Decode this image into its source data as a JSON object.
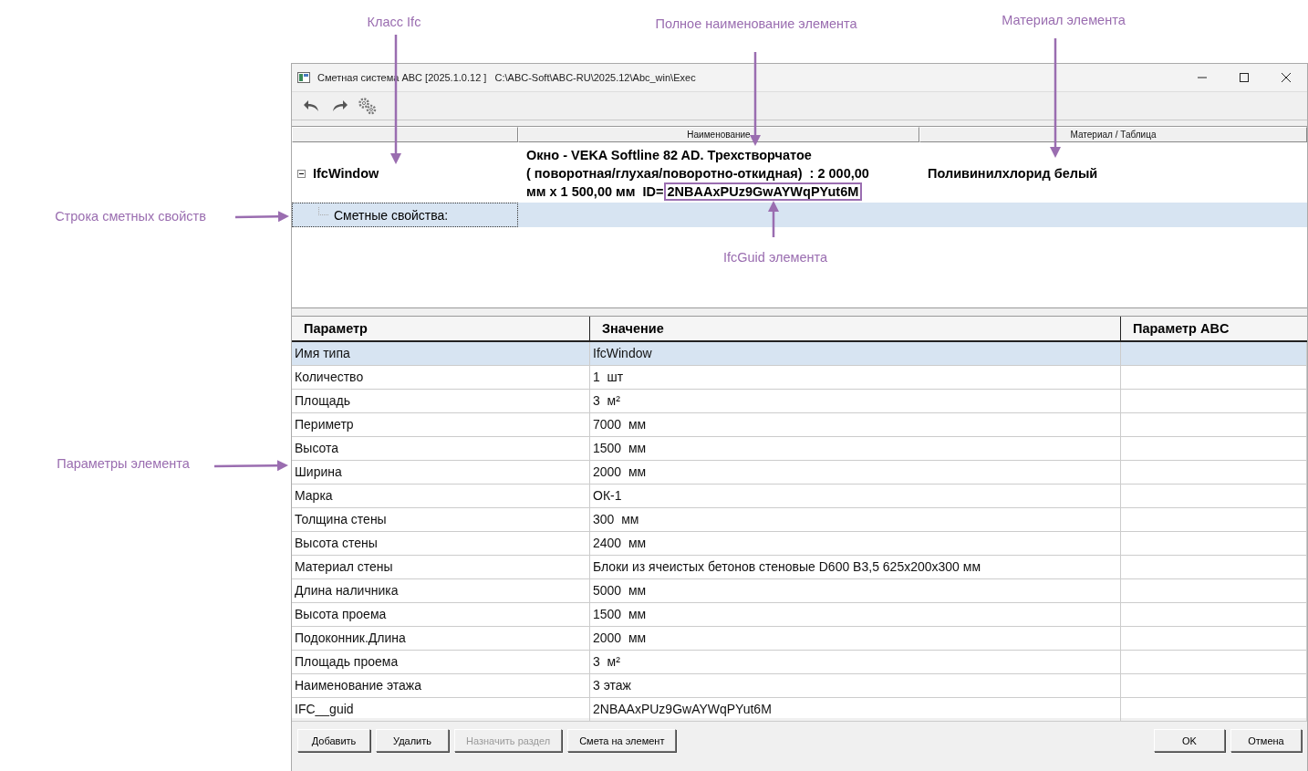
{
  "window": {
    "title": "Сметная система ABC [2025.1.0.12 ]   C:\\ABC-Soft\\ABC-RU\\2025.12\\Abc_win\\Exec"
  },
  "tree": {
    "columns": [
      "Наименование",
      "Материал / Таблица"
    ],
    "rows": [
      {
        "class": "IfcWindow",
        "expanded": true,
        "name_lines": [
          "Окно - VEKA Softline 82 AD. Трехстворчатое",
          "( поворотная/глухая/поворотно-откидная)  : 2 000,00",
          "мм x 1 500,00 мм  ID="
        ],
        "guid": "2NBAAxPUz9GwAYWqPYut6M",
        "material": "Поливинилхлорид белый",
        "children": [
          {
            "label": "Сметные свойства:",
            "selected": true
          }
        ]
      }
    ]
  },
  "grid": {
    "columns": [
      "Параметр",
      "Значение",
      "Параметр ABC"
    ],
    "rows": [
      {
        "param": "Имя типа",
        "value": "IfcWindow",
        "selected": true
      },
      {
        "param": "Количество",
        "value": "1  шт",
        "selected": false
      },
      {
        "param": "Площадь",
        "value": "3  м²",
        "selected": false
      },
      {
        "param": "Периметр",
        "value": "7000  мм",
        "selected": false
      },
      {
        "param": "Высота",
        "value": "1500  мм",
        "selected": false
      },
      {
        "param": "Ширина",
        "value": "2000  мм",
        "selected": false
      },
      {
        "param": "Марка",
        "value": "ОК-1",
        "selected": false
      },
      {
        "param": "Толщина стены",
        "value": "300  мм",
        "selected": false
      },
      {
        "param": "Высота стены",
        "value": "2400  мм",
        "selected": false
      },
      {
        "param": "Материал стены",
        "value": "Блоки из ячеистых бетонов стеновые D600 B3,5 625x200x300 мм",
        "selected": false
      },
      {
        "param": "Длина наличника",
        "value": "5000  мм",
        "selected": false
      },
      {
        "param": "Высота проема",
        "value": "1500  мм",
        "selected": false
      },
      {
        "param": "Подоконник.Длина",
        "value": "2000  мм",
        "selected": false
      },
      {
        "param": "Площадь проема",
        "value": "3  м²",
        "selected": false
      },
      {
        "param": "Наименование этажа",
        "value": "3 этаж",
        "selected": false
      },
      {
        "param": "IFC__guid",
        "value": "2NBAAxPUz9GwAYWqPYut6M",
        "selected": false
      }
    ]
  },
  "buttons_left": [
    {
      "label": "Добавить",
      "disabled": false
    },
    {
      "label": "Удалить",
      "disabled": false
    },
    {
      "label": "Назначить раздел",
      "disabled": true
    },
    {
      "label": "Смета на элемент",
      "disabled": false
    }
  ],
  "buttons_right": [
    {
      "label": "OK",
      "disabled": false
    },
    {
      "label": "Отмена",
      "disabled": false
    }
  ],
  "annotations": [
    {
      "text": "Класс Ifc"
    },
    {
      "text": "Полное наименование элемента"
    },
    {
      "text": "Материал элемента"
    },
    {
      "text": "Строка сметных свойств"
    },
    {
      "text": "IfcGuid элемента"
    },
    {
      "text": "Параметры элемента"
    }
  ]
}
